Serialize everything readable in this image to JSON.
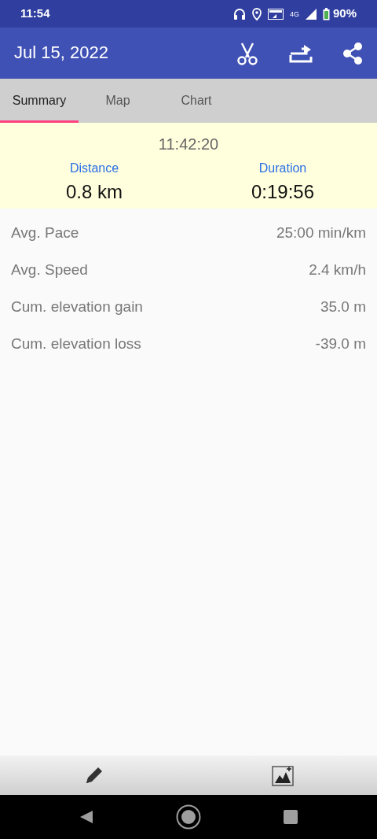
{
  "status_bar": {
    "time": "11:54",
    "network": "4G",
    "battery": "90%"
  },
  "app_bar": {
    "title": "Jul 15, 2022"
  },
  "tabs": [
    {
      "label": "Summary",
      "selected": true
    },
    {
      "label": "Map",
      "selected": false
    },
    {
      "label": "Chart",
      "selected": false
    }
  ],
  "summary": {
    "start_time": "11:42:20",
    "stats": [
      {
        "label": "Distance",
        "value": "0.8 km"
      },
      {
        "label": "Duration",
        "value": "0:19:56"
      }
    ]
  },
  "details": [
    {
      "label": "Avg. Pace",
      "value": "25:00 min/km"
    },
    {
      "label": "Avg. Speed",
      "value": "2.4 km/h"
    },
    {
      "label": "Cum. elevation gain",
      "value": "35.0 m"
    },
    {
      "label": "Cum. elevation loss",
      "value": "-39.0 m"
    }
  ]
}
